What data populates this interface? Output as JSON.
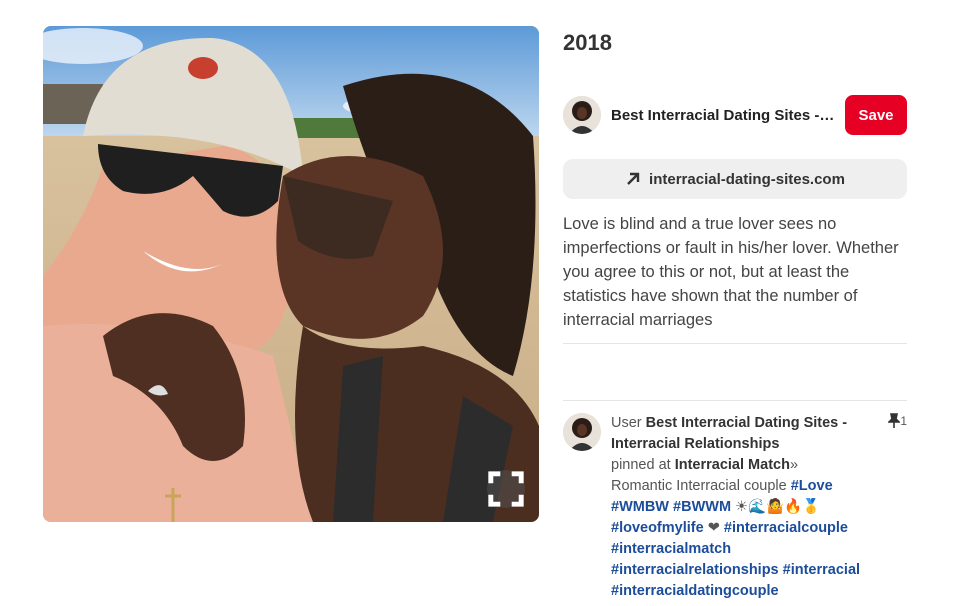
{
  "pin": {
    "title": "2018",
    "image_alt": "Couple selfie on the beach, woman kissing man's cheek"
  },
  "source": {
    "name": "Best Interracial Dating Sites - ...",
    "save_label": "Save",
    "link_text": "interracial-dating-sites.com"
  },
  "description": "Love is blind and a true lover sees no imperfections or fault in his/her lover. Whether you agree to this or not, but at least the statistics have shown that the number of interracial marriages",
  "activity": {
    "prefix": "User ",
    "user": "Best Interracial Dating Sites - Interracial Relationships",
    "pinned_at": "pinned at ",
    "board": "Interracial Match",
    "board_suffix": "»",
    "caption": "Romantic Interracial couple ",
    "tags_1": [
      "#Love",
      "#WMBW",
      "#BWWM"
    ],
    "emojis": "☀🌊🤷🔥🥇",
    "tags_2": [
      "#loveofmylife"
    ],
    "heart": "❤",
    "tags_3": [
      "#interracialcouple",
      "#interracialmatch",
      "#interracialrelationships",
      "#interracial",
      "#interracialdatingcouple"
    ],
    "pin_count": "1"
  },
  "colors": {
    "save_button": "#e60023",
    "hashtag": "#1b4d9b",
    "link_bar": "#efefef"
  }
}
